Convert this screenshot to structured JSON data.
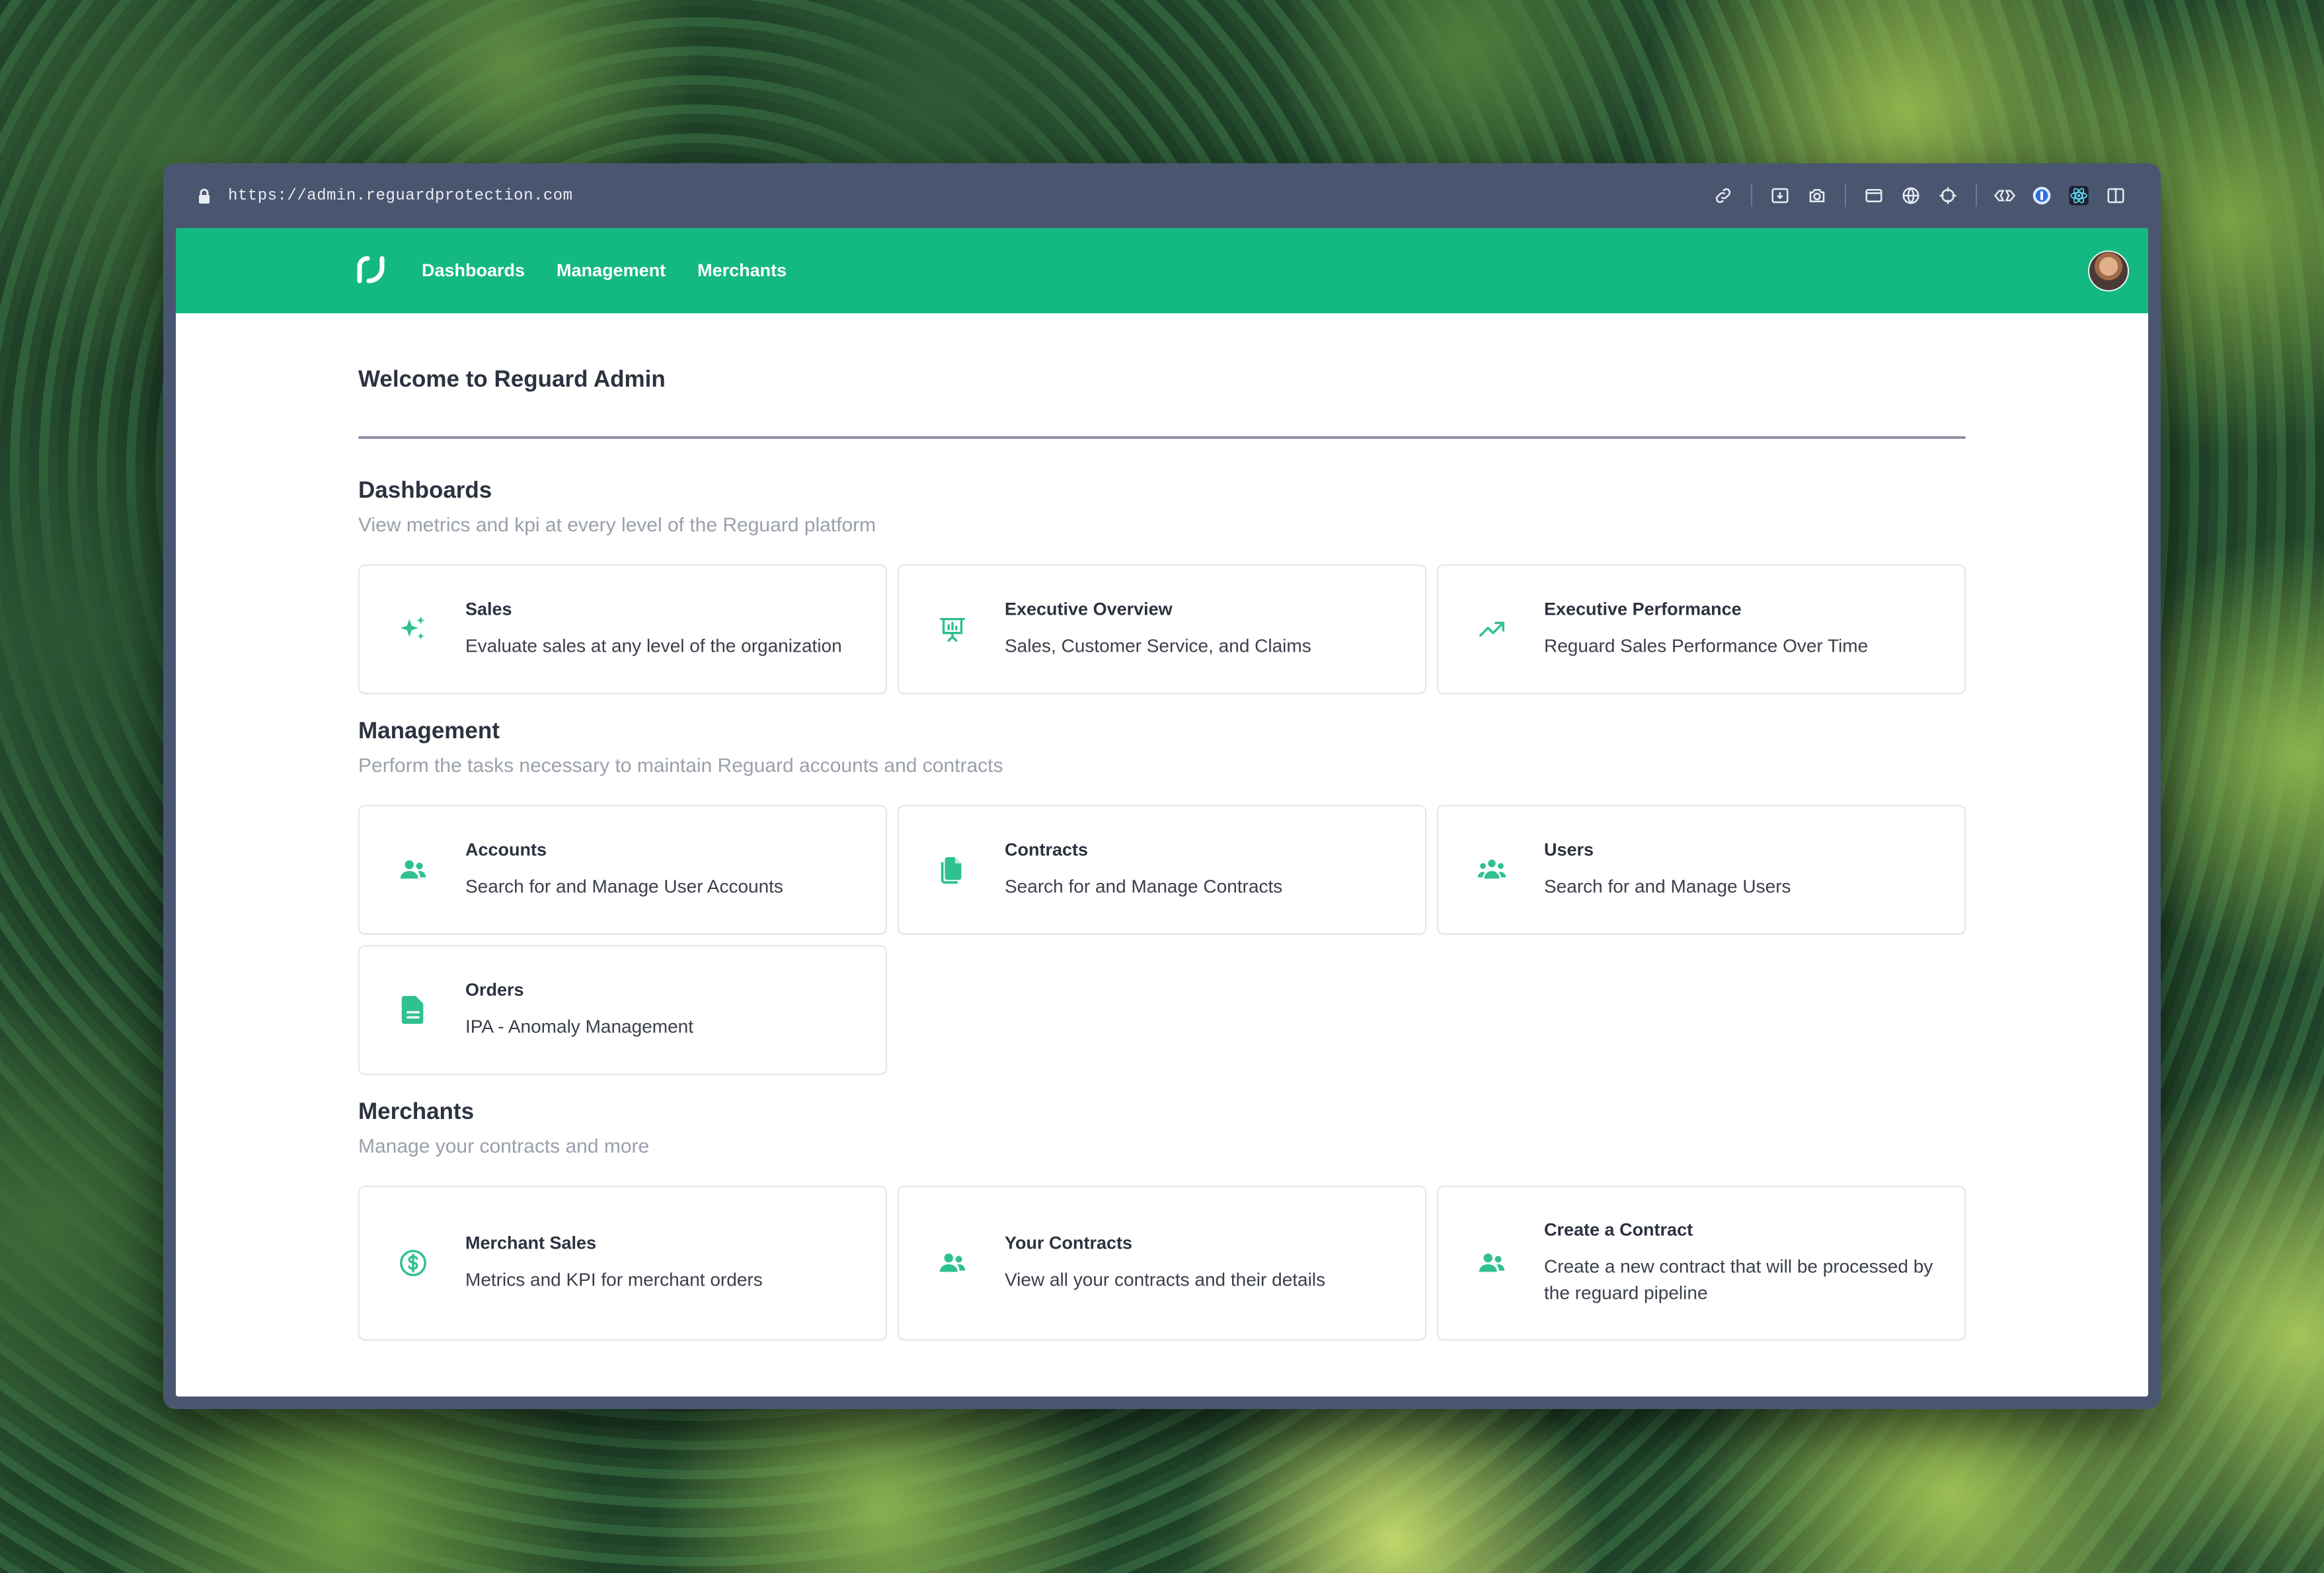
{
  "browser": {
    "url": "https://admin.reguardprotection.com",
    "toolbar_icons": [
      "link-icon",
      "download-icon",
      "camera-icon",
      "terminal-icon",
      "globe-icon",
      "crosshair-icon",
      "extension-icon",
      "password-icon",
      "react-icon",
      "sidebar-icon"
    ]
  },
  "nav": {
    "links": [
      "Dashboards",
      "Management",
      "Merchants"
    ],
    "brand_color": "#14b883"
  },
  "page": {
    "title": "Welcome to Reguard Admin"
  },
  "sections": [
    {
      "title": "Dashboards",
      "description": "View metrics and kpi at every level of the Reguard platform",
      "cards": [
        {
          "title": "Sales",
          "description": "Evaluate sales at any level of the organization",
          "icon": "sparkles-icon"
        },
        {
          "title": "Executive Overview",
          "description": "Sales, Customer Service, and Claims",
          "icon": "presentation-chart-icon"
        },
        {
          "title": "Executive Performance",
          "description": "Reguard Sales Performance Over Time",
          "icon": "trending-up-icon"
        }
      ]
    },
    {
      "title": "Management",
      "description": "Perform the tasks necessary to maintain Reguard accounts and contracts",
      "cards": [
        {
          "title": "Accounts",
          "description": "Search for and Manage User Accounts",
          "icon": "users-icon"
        },
        {
          "title": "Contracts",
          "description": "Search for and Manage Contracts",
          "icon": "documents-icon"
        },
        {
          "title": "Users",
          "description": "Search for and Manage Users",
          "icon": "user-group-icon"
        },
        {
          "title": "Orders",
          "description": "IPA - Anomaly Management",
          "icon": "document-text-icon"
        }
      ]
    },
    {
      "title": "Merchants",
      "description": "Manage your contracts and more",
      "cards": [
        {
          "title": "Merchant Sales",
          "description": "Metrics and KPI for merchant orders",
          "icon": "currency-dollar-icon"
        },
        {
          "title": "Your Contracts",
          "description": "View all your contracts and their details",
          "icon": "users-icon"
        },
        {
          "title": "Create a Contract",
          "description": "Create a new contract that will be processed by the reguard pipeline",
          "icon": "users-icon"
        }
      ]
    }
  ]
}
